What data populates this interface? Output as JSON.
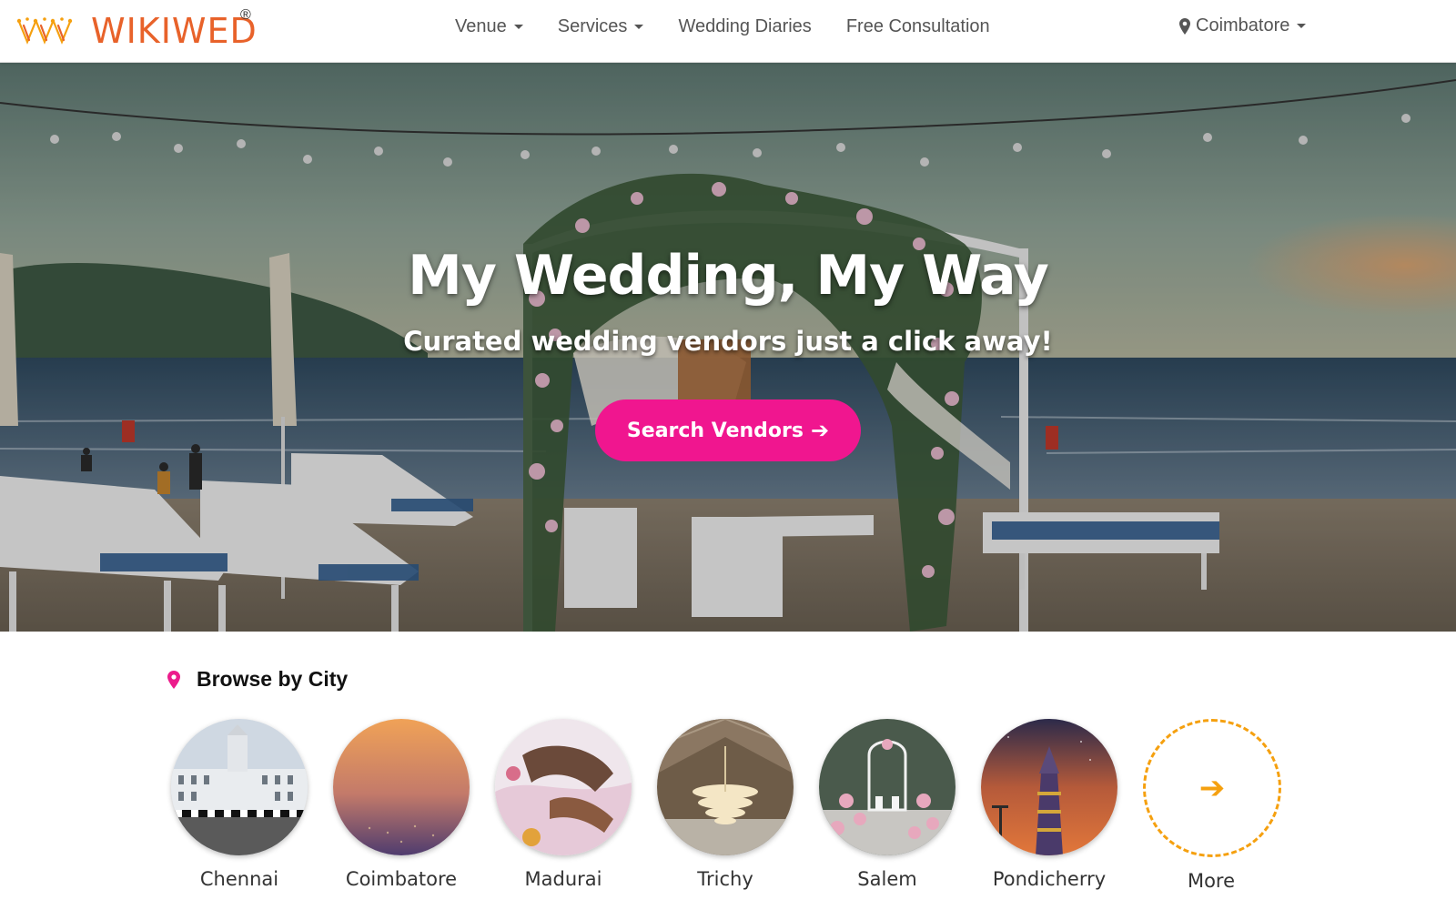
{
  "brand": {
    "name": "WIKIWED",
    "registered": "®"
  },
  "nav": {
    "items": [
      {
        "label": "Venue",
        "has_dropdown": true
      },
      {
        "label": "Services",
        "has_dropdown": true
      },
      {
        "label": "Wedding Diaries",
        "has_dropdown": false
      },
      {
        "label": "Free Consultation",
        "has_dropdown": false
      }
    ],
    "location": {
      "label": "Coimbatore",
      "icon": "map-pin-icon"
    }
  },
  "hero": {
    "title": "My Wedding, My Way",
    "subtitle": "Curated wedding vendors just a click away!",
    "cta_label": "Search Vendors",
    "cta_icon": "arrow-right-icon"
  },
  "browse": {
    "title": "Browse by City",
    "icon": "map-pin-icon",
    "cities": [
      {
        "name": "Chennai"
      },
      {
        "name": "Coimbatore"
      },
      {
        "name": "Madurai"
      },
      {
        "name": "Trichy"
      },
      {
        "name": "Salem"
      },
      {
        "name": "Pondicherry"
      },
      {
        "name": "More"
      }
    ]
  },
  "colors": {
    "brand_orange": "#e8622a",
    "cta_pink": "#f0168f",
    "more_orange": "#f5a00f",
    "pin_pink": "#ec1c8c"
  }
}
